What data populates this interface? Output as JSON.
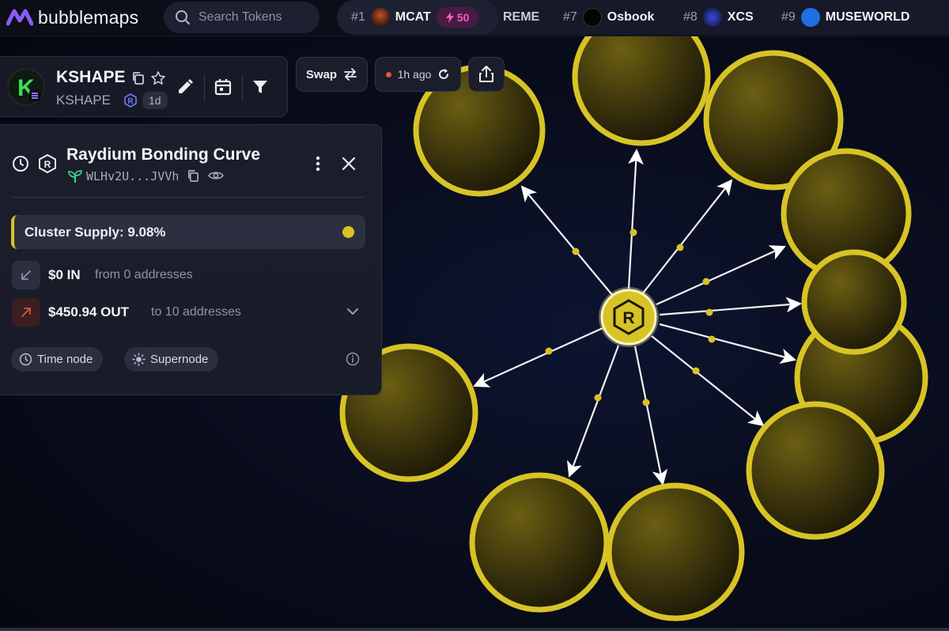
{
  "brand": {
    "name": "bubblemaps"
  },
  "search": {
    "placeholder": "Search Tokens"
  },
  "ticker": [
    {
      "rank": "#1",
      "name": "MCAT",
      "boost": "50"
    },
    {
      "name_fragment": "REME"
    },
    {
      "rank": "#7",
      "name": "Osbook"
    },
    {
      "rank": "#8",
      "name": "XCS"
    },
    {
      "rank": "#9",
      "name": "MUSEWORLD"
    }
  ],
  "token": {
    "name": "KSHAPE",
    "symbol": "KSHAPE",
    "age": "1d",
    "logo_letter": "K"
  },
  "toolbar": {
    "swap_label": "Swap",
    "refresh_label": "1h ago"
  },
  "panel": {
    "title": "Raydium Bonding Curve",
    "address": "WLHv2U...JVVh",
    "cluster_supply": "Cluster Supply: 9.08%",
    "in_amount": "$0 IN",
    "in_sub": "from 0 addresses",
    "out_amount": "$450.94 OUT",
    "out_sub": "to 10 addresses",
    "tags": [
      "Time node",
      "Supernode"
    ]
  },
  "graph": {
    "center_label": "R",
    "node_color": "#d8c326",
    "node_count": 10
  },
  "colors": {
    "accent": "#d8c326",
    "boost": "#f05ac6",
    "out": "#e0533f"
  }
}
